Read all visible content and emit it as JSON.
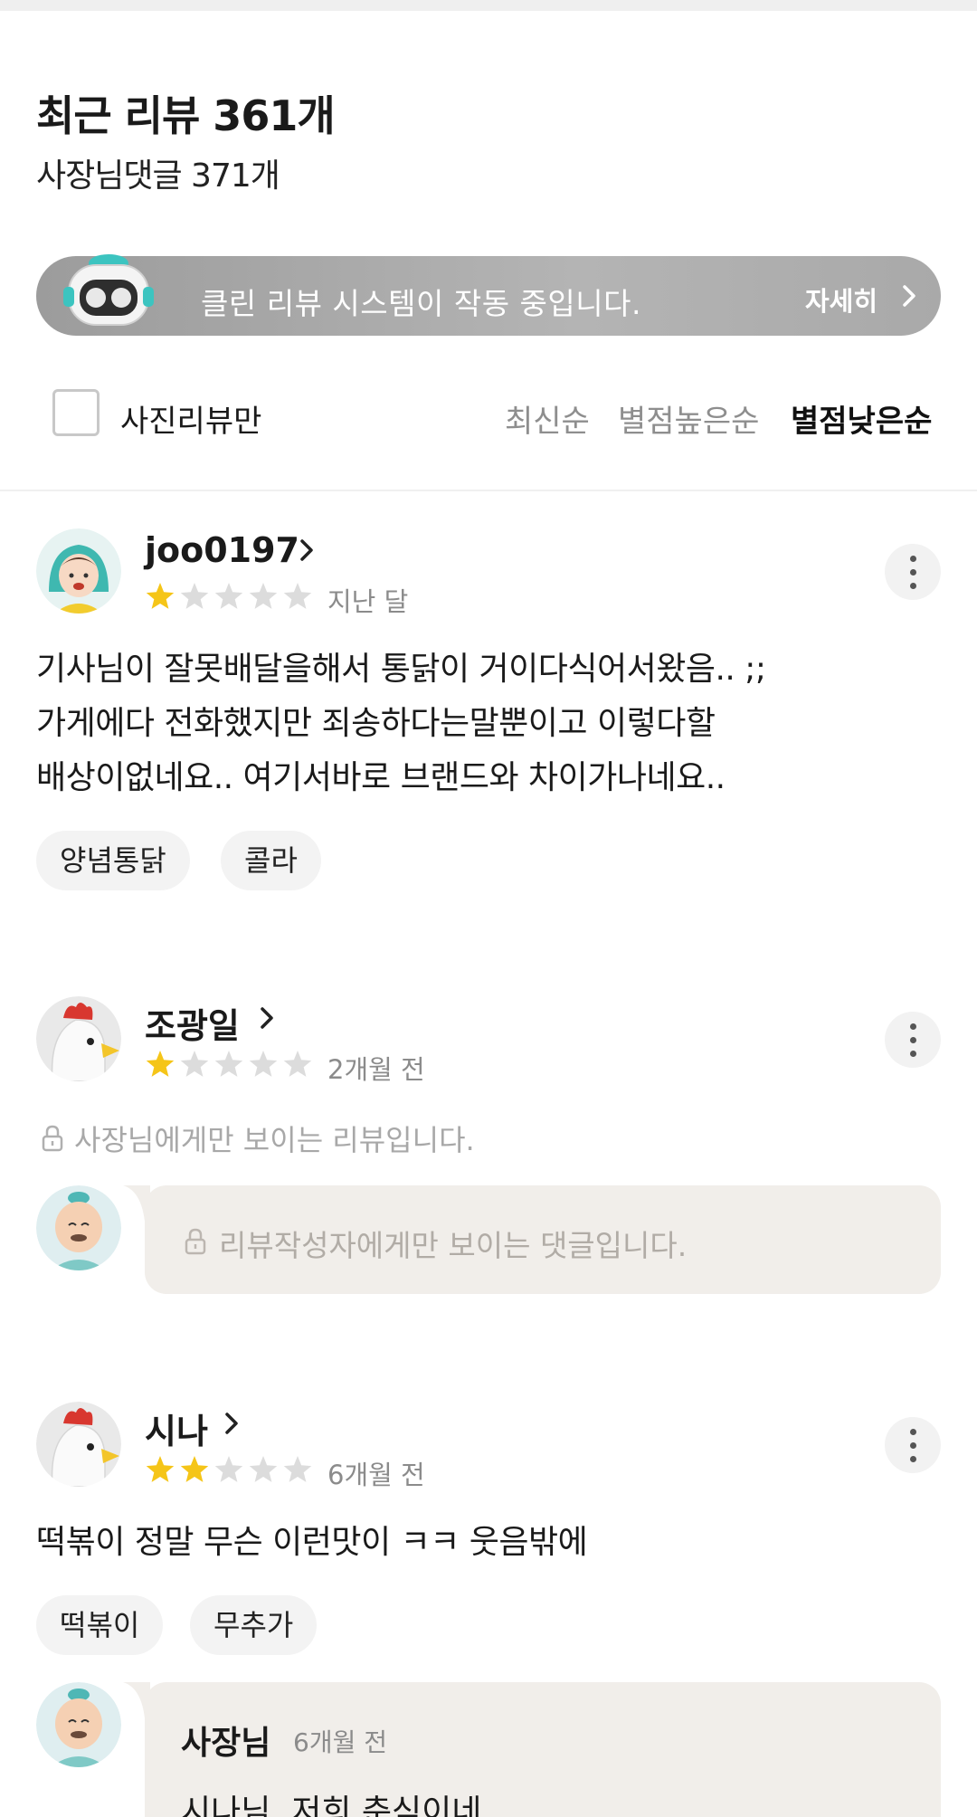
{
  "header": {
    "title": "최근 리뷰 361개",
    "subtitle": "사장님댓글 371개"
  },
  "banner": {
    "text": "클린 리뷰 시스템이 작동 중입니다.",
    "more_label": "자세히"
  },
  "filter": {
    "photo_only_label": "사진리뷰만",
    "photo_only_checked": false,
    "sort_options": [
      "최신순",
      "별점높은순",
      "별점낮은순"
    ],
    "selected_sort": "별점낮은순"
  },
  "reviews": [
    {
      "username": "joo0197",
      "rating": 1,
      "date": "지난 달",
      "text_lines": [
        "기사님이 잘못배달을해서 통닭이 거이다식어서왔음.. ;;",
        "가게에다 전화했지만 죄송하다는말뿐이고 이렇다할",
        "배상이없네요.. 여기서바로 브랜드와 차이가나네요.."
      ],
      "tags": [
        "양념통닭",
        "콜라"
      ]
    },
    {
      "username": "조광일",
      "rating": 1,
      "date": "2개월 전",
      "private_note": "사장님에게만 보이는 리뷰입니다.",
      "owner_reply_private": "리뷰작성자에게만 보이는 댓글입니다."
    },
    {
      "username": "시나",
      "rating": 2,
      "date": "6개월 전",
      "text": "떡볶이 정말 무슨 이런맛이 ㅋㅋ 웃음밖에",
      "tags": [
        "떡볶이",
        "무추가"
      ],
      "owner_reply": {
        "name": "사장님",
        "date": "6개월 전",
        "text": "시나님, 저희 춘식이네"
      }
    }
  ],
  "colors": {
    "star_filled": "#F5C518",
    "star_empty": "#DCDCDC",
    "bubble_bg": "#F1EEEA",
    "banner_bg": "#A6A6A6"
  }
}
